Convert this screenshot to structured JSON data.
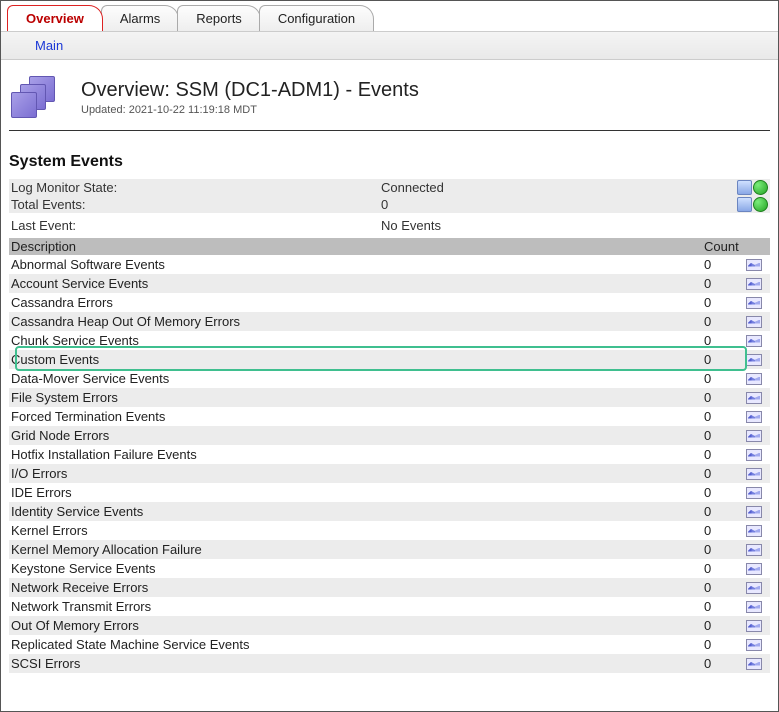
{
  "tabs": [
    "Overview",
    "Alarms",
    "Reports",
    "Configuration"
  ],
  "active_tab": 0,
  "subnav": {
    "main": "Main"
  },
  "header": {
    "title": "Overview: SSM (DC1-ADM1) - Events",
    "updated": "Updated: 2021-10-22 11:19:18 MDT"
  },
  "section_title": "System Events",
  "status": [
    {
      "label": "Log Monitor State:",
      "value": "Connected",
      "icons": [
        "blue",
        "green"
      ],
      "alt": true
    },
    {
      "label": "Total Events:",
      "value": "0",
      "icons": [
        "blue",
        "green"
      ],
      "alt": true
    }
  ],
  "last_event": {
    "label": "Last Event:",
    "value": "No Events"
  },
  "columns": {
    "description": "Description",
    "count": "Count"
  },
  "events": [
    {
      "description": "Abnormal Software Events",
      "count": 0
    },
    {
      "description": "Account Service Events",
      "count": 0
    },
    {
      "description": "Cassandra Errors",
      "count": 0
    },
    {
      "description": "Cassandra Heap Out Of Memory Errors",
      "count": 0
    },
    {
      "description": "Chunk Service Events",
      "count": 0
    },
    {
      "description": "Custom Events",
      "count": 0,
      "highlighted": true
    },
    {
      "description": "Data-Mover Service Events",
      "count": 0
    },
    {
      "description": "File System Errors",
      "count": 0
    },
    {
      "description": "Forced Termination Events",
      "count": 0
    },
    {
      "description": "Grid Node Errors",
      "count": 0
    },
    {
      "description": "Hotfix Installation Failure Events",
      "count": 0
    },
    {
      "description": "I/O Errors",
      "count": 0
    },
    {
      "description": "IDE Errors",
      "count": 0
    },
    {
      "description": "Identity Service Events",
      "count": 0
    },
    {
      "description": "Kernel Errors",
      "count": 0
    },
    {
      "description": "Kernel Memory Allocation Failure",
      "count": 0
    },
    {
      "description": "Keystone Service Events",
      "count": 0
    },
    {
      "description": "Network Receive Errors",
      "count": 0
    },
    {
      "description": "Network Transmit Errors",
      "count": 0
    },
    {
      "description": "Out Of Memory Errors",
      "count": 0
    },
    {
      "description": "Replicated State Machine Service Events",
      "count": 0
    },
    {
      "description": "SCSI Errors",
      "count": 0
    }
  ]
}
